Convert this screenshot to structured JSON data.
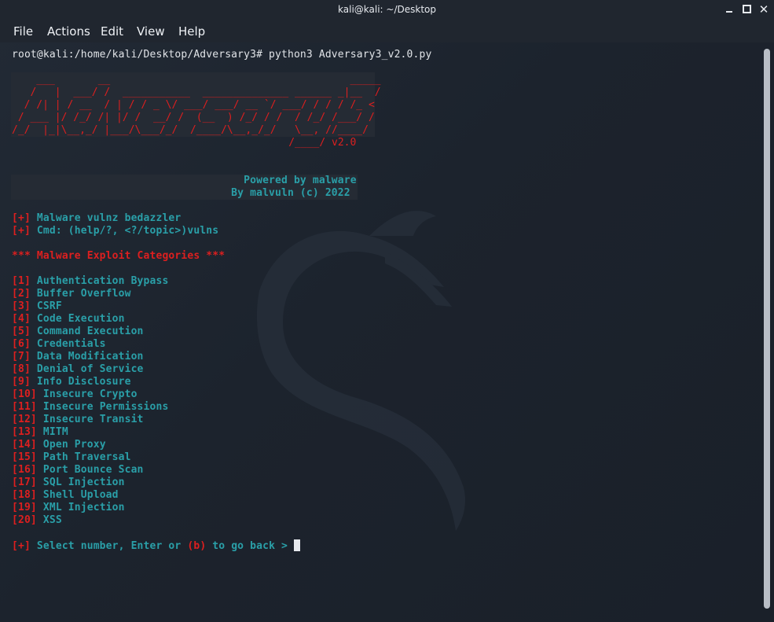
{
  "window": {
    "title": "kali@kali: ~/Desktop"
  },
  "menu": [
    "File",
    "Actions",
    "Edit",
    "View",
    "Help"
  ],
  "terminal": {
    "command_line": "root@kali:/home/kali/Desktop/Adversary3# python3 Adversary3_v2.0.py",
    "banner_art": "    ___       __                                       _____\n   /   |  ___/ /  ___________  ______________ ______ _|__  /\n  / /| | / __  / | / / _ \\/ ___/ ___/ __ `/ ___/ / / / /_ <\n / ___ |/ /_/ /| |/ /  __/ /  (__  ) /_/ / /  / /_/ /___/ /\n/_/  |_|\\__,_/ |___/\\___/_/  /____/\\__,_/_/   \\__, //____/\n                                             /____/ v2.0",
    "powered_by": "                                     Powered by malware",
    "credit": "                                   By malvuln (c) 2022",
    "info": [
      {
        "tag": "[+]",
        "text": " Malware vulnz bedazzler"
      },
      {
        "tag": "[+]",
        "text": " Cmd: (help/?, <?/topic>)vulns"
      }
    ],
    "categories_title": "*** Malware Exploit Categories ***",
    "categories": [
      {
        "num": "[1]",
        "name": " Authentication Bypass"
      },
      {
        "num": "[2]",
        "name": " Buffer Overflow"
      },
      {
        "num": "[3]",
        "name": " CSRF"
      },
      {
        "num": "[4]",
        "name": " Code Execution"
      },
      {
        "num": "[5]",
        "name": " Command Execution"
      },
      {
        "num": "[6]",
        "name": " Credentials"
      },
      {
        "num": "[7]",
        "name": " Data Modification"
      },
      {
        "num": "[8]",
        "name": " Denial of Service"
      },
      {
        "num": "[9]",
        "name": " Info Disclosure"
      },
      {
        "num": "[10]",
        "name": " Insecure Crypto"
      },
      {
        "num": "[11]",
        "name": " Insecure Permissions"
      },
      {
        "num": "[12]",
        "name": " Insecure Transit"
      },
      {
        "num": "[13]",
        "name": " MITM"
      },
      {
        "num": "[14]",
        "name": " Open Proxy"
      },
      {
        "num": "[15]",
        "name": " Path Traversal"
      },
      {
        "num": "[16]",
        "name": " Port Bounce Scan"
      },
      {
        "num": "[17]",
        "name": " SQL Injection"
      },
      {
        "num": "[18]",
        "name": " Shell Upload"
      },
      {
        "num": "[19]",
        "name": " XML Injection"
      },
      {
        "num": "[20]",
        "name": " XSS"
      }
    ],
    "prompt": {
      "tag": "[+]",
      "before": " Select number, Enter or ",
      "key": "(b)",
      "after": " to go back > "
    }
  },
  "colors": {
    "background": "#1d232d",
    "red": "#dd1f1f",
    "teal": "#2a9fa8",
    "white": "#e1e4e8"
  },
  "icons": [
    "minimize-icon",
    "maximize-icon",
    "close-icon",
    "kali-dragon-watermark"
  ]
}
